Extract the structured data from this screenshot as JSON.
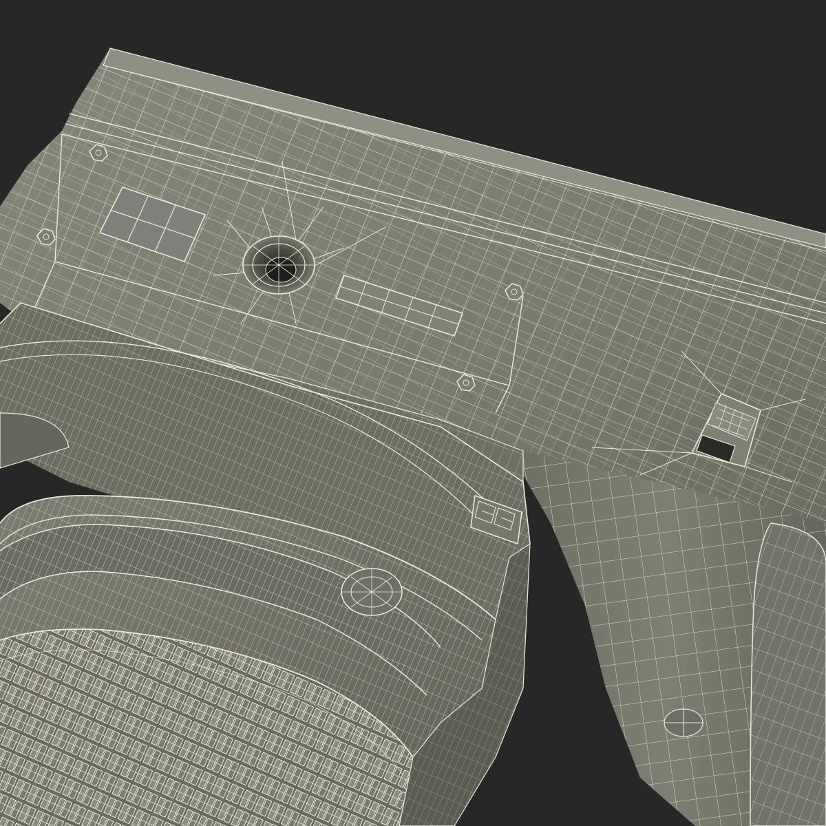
{
  "scene": {
    "background_color": "#272727",
    "surface_color": "#7b7b6e",
    "surface_light_color": "#8a8a7e",
    "surface_dark_color": "#5f5f55",
    "wire_color": "#ecebd8",
    "shadow_color": "#4a4a42"
  },
  "model": {
    "subject": "camera-wireframe-render",
    "parts": [
      {
        "name": "camera-body"
      },
      {
        "name": "bottom-plate"
      },
      {
        "name": "tripod-socket"
      },
      {
        "name": "battery-door"
      },
      {
        "name": "serial-label-area"
      },
      {
        "name": "hand-grip"
      },
      {
        "name": "strap-lug"
      },
      {
        "name": "lens-mount"
      },
      {
        "name": "lens-barrel"
      },
      {
        "name": "focus-ring"
      },
      {
        "name": "zoom-ring-knurling"
      },
      {
        "name": "lens-release-button"
      },
      {
        "name": "mount-logo-plate"
      }
    ],
    "screws": 4
  }
}
